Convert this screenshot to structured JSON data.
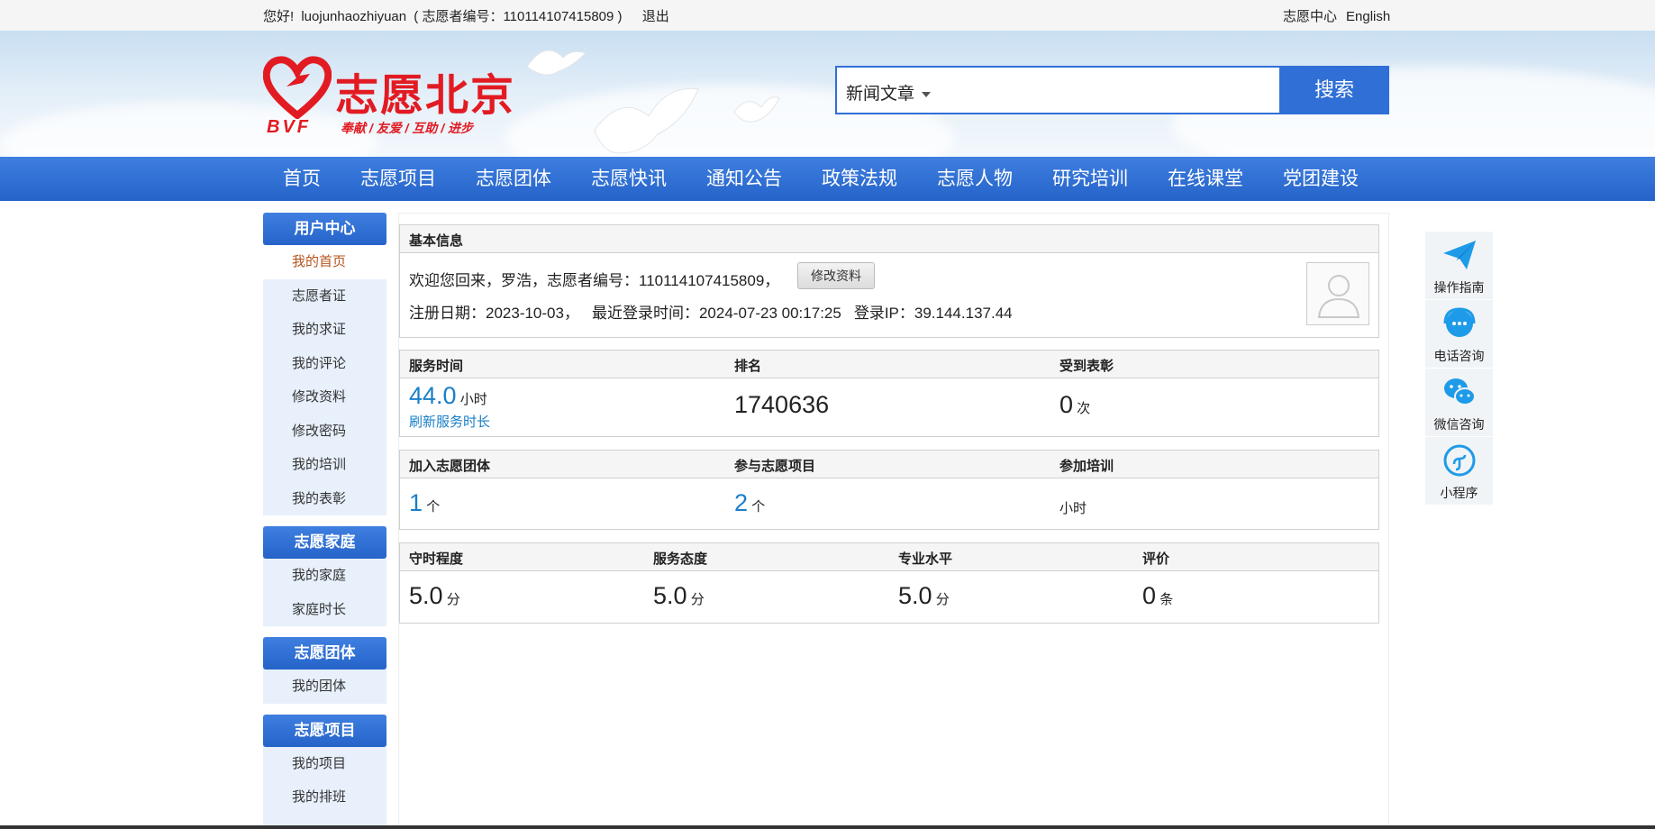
{
  "topbar": {
    "greeting": "您好!",
    "username": "luojunhaozhiyuan",
    "volunteer_no_text": "( 志愿者编号：110114107415809 )",
    "logout": "退出",
    "center": "志愿中心",
    "english": "English"
  },
  "banner": {
    "logo_cn": "志愿北京",
    "logo_bvf": "BVF",
    "logo_slogan": "奉献 / 友爱 / 互助 / 进步",
    "search_category": "新闻文章",
    "search_placeholder": "",
    "search_button": "搜索"
  },
  "nav": [
    "首页",
    "志愿项目",
    "志愿团体",
    "志愿快讯",
    "通知公告",
    "政策法规",
    "志愿人物",
    "研究培训",
    "在线课堂",
    "党团建设"
  ],
  "sidebar": {
    "user_center": "用户中心",
    "user_items": [
      "我的首页",
      "志愿者证",
      "我的求证",
      "我的评论",
      "修改资料",
      "修改密码",
      "我的培训",
      "我的表彰"
    ],
    "family": "志愿家庭",
    "family_items": [
      "我的家庭",
      "家庭时长"
    ],
    "team": "志愿团体",
    "team_items": [
      "我的团体"
    ],
    "project": "志愿项目",
    "project_items": [
      "我的项目",
      "我的排班"
    ]
  },
  "basic": {
    "title": "基本信息",
    "welcome": "欢迎您回来，罗浩，志愿者编号：110114107415809，",
    "edit_button": "修改资料",
    "reg_date": "注册日期：2023-10-03，",
    "last_login": "最近登录时间：2024-07-23 00:17:25",
    "login_ip": "登录IP：39.144.137.44"
  },
  "stats1": {
    "service_time_label": "服务时间",
    "service_time_value": "44.0",
    "service_time_unit": "小时",
    "refresh_link": "刷新服务时长",
    "rank_label": "排名",
    "rank_value": "1740636",
    "honor_label": "受到表彰",
    "honor_value": "0",
    "honor_unit": "次"
  },
  "stats2": {
    "team_label": "加入志愿团体",
    "team_value": "1",
    "team_unit": "个",
    "project_label": "参与志愿项目",
    "project_value": "2",
    "project_unit": "个",
    "training_label": "参加培训",
    "training_unit": "小时"
  },
  "stats3": {
    "punctual_label": "守时程度",
    "punctual_value": "5.0",
    "attitude_label": "服务态度",
    "attitude_value": "5.0",
    "professional_label": "专业水平",
    "professional_value": "5.0",
    "score_unit": "分",
    "review_label": "评价",
    "review_value": "0",
    "review_unit": "条"
  },
  "float": [
    "操作指南",
    "电话咨询",
    "微信咨询",
    "小程序"
  ],
  "colors": {
    "primary_blue": "#2f6fd6",
    "brand_red": "#e21b23",
    "stat_blue": "#1a7fc9"
  }
}
